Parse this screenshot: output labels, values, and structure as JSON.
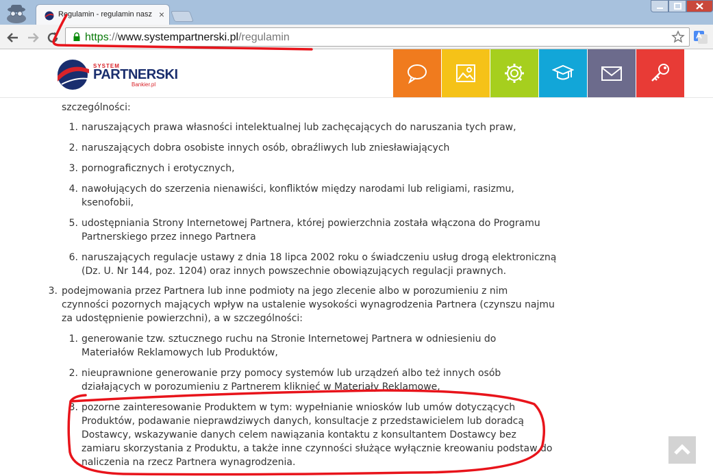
{
  "browser": {
    "tab_title": "Regulamin - regulamin nasz",
    "tab_close": "×",
    "url": {
      "scheme": "https",
      "separator": "://",
      "host": "www.systempartnerski.pl",
      "path": "/regulamin"
    }
  },
  "logo": {
    "system": "SYSTEM",
    "partnerski": "PARTNERSKI",
    "bankier": "Bankier.pl"
  },
  "nav_tiles": [
    {
      "icon": "speech-bubble-icon",
      "color": "#f07b1e"
    },
    {
      "icon": "image-icon",
      "color": "#f5c218"
    },
    {
      "icon": "gear-icon",
      "color": "#a6cf1e"
    },
    {
      "icon": "graduation-cap-icon",
      "color": "#12a6d8"
    },
    {
      "icon": "envelope-icon",
      "color": "#6c6b8c"
    },
    {
      "icon": "key-icon",
      "color": "#e83b36"
    }
  ],
  "content": {
    "top_fragment": "szczególności:",
    "list_a": [
      {
        "n": "1.",
        "lines": [
          "naruszających prawa własności intelektualnej lub zachęcających do naruszania tych praw,"
        ]
      },
      {
        "n": "2.",
        "lines": [
          "naruszających dobra osobiste innych osób, obraźliwych lub zniesławiających"
        ]
      },
      {
        "n": "3.",
        "lines": [
          "pornograficznych i erotycznych,"
        ]
      },
      {
        "n": "4.",
        "lines": [
          "nawołujących do szerzenia nienawiści, konfliktów między narodami lub religiami, rasizmu,",
          "ksenofobii,"
        ]
      },
      {
        "n": "5.",
        "lines": [
          "udostępniania Strony Internetowej Partnera, której powierzchnia została włączona do Programu",
          "Partnerskiego przez innego Partnera"
        ]
      },
      {
        "n": "6.",
        "lines": [
          "naruszających regulacje ustawy z dnia 18 lipca 2002 roku o świadczeniu usług drogą elektroniczną",
          "(Dz. U. Nr 144, poz. 1204) oraz innych powszechnie obowiązujących regulacji prawnych."
        ]
      }
    ],
    "item3": {
      "n": "3.",
      "lines": [
        "podejmowania przez Partnera lub inne podmioty na jego zlecenie albo w porozumieniu z nim",
        "czynności pozornych mających wpływ na ustalenie wysokości wynagrodzenia Partnera (czynszu najmu",
        "za udostępnienie powierzchni), a w szczególności:"
      ]
    },
    "list_b": [
      {
        "n": "1.",
        "lines": [
          "generowanie tzw. sztucznego ruchu na Stronie Internetowej Partnera w odniesieniu do",
          "Materiałów Reklamowych lub Produktów,"
        ]
      },
      {
        "n": "2.",
        "lines": [
          "nieuprawnione generowanie przy pomocy systemów lub urządzeń albo też innych osób",
          "działających w porozumieniu z Partnerem kliknięć w Materiały Reklamowe,"
        ]
      },
      {
        "n": "3.",
        "lines": [
          "pozorne zainteresowanie Produktem w tym: wypełnianie wniosków lub umów dotyczących",
          "Produktów, podawanie nieprawdziwych danych, konsultacje z przedstawicielem lub doradcą",
          "Dostawcy, wskazywanie danych celem nawiązania kontaktu z konsultantem Dostawcy bez",
          "zamiaru skorzystania z Produktu, a także inne czynności służące wyłącznie kreowaniu podstaw do",
          "naliczenia na rzecz Partnera wynagrodzenia."
        ]
      }
    ]
  },
  "annotation_color": "#e8141b"
}
